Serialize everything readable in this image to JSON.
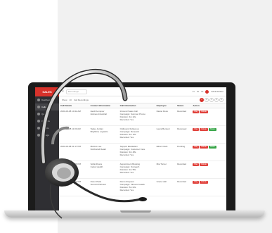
{
  "app": {
    "logo": "SALES",
    "nav": [
      "Dashboard",
      "Calls",
      "Queue",
      "Contacts",
      "Reports",
      "Settings"
    ]
  },
  "topbar": {
    "search_placeholder": "Recordings",
    "zoom": [
      "1x",
      "2x",
      "3x"
    ],
    "user": "Administrator"
  },
  "toolbar": {
    "show": "Show",
    "entries": "10",
    "filter": "Call Recordings",
    "pages": [
      "1",
      "2",
      "3",
      "4",
      "5"
    ]
  },
  "table": {
    "headers": [
      "Call Details",
      "Contact Information",
      "Call Information",
      "Employee",
      "Status",
      "Action"
    ],
    "rows": [
      {
        "details": "2021-06-08 10:42 AM",
        "contact": "Heidi Kempner\nHolmes Industrial",
        "info": "Inbound Sales Call\nCampaign: Summer Promo\nDuration: 4m 22s\nRecorded: Yes",
        "employee": "Daniel Ross",
        "status": "Recorded",
        "actions": [
          "Play",
          "Delete"
        ]
      },
      {
        "details": "2021-06-08 11:03 AM",
        "contact": "Tadeo Jordan\nBrightline Logistics",
        "info": "Outbound Follow-up\nCampaign: Renewal\nDuration: 6m 10s\nRecorded: Yes",
        "employee": "Laura Bennett",
        "status": "Reviewed",
        "actions": [
          "Play",
          "Delete",
          "Share"
        ]
      },
      {
        "details": "2021-06-08 01:17 PM",
        "contact": "Marcus Lee\nNorthwind Retail",
        "info": "Support Escalation\nCampaign: Customer Care\nDuration: 3m 48s\nRecorded: Yes",
        "employee": "Ethan Clark",
        "status": "Pending",
        "actions": [
          "Play",
          "Delete",
          "Share"
        ]
      },
      {
        "details": "2021-06-08 02:29 PM",
        "contact": "Sofia Rivera\nCedar Health",
        "info": "Appointment Booking\nCampaign: Outreach\nDuration: 2m 55s\nRecorded: Yes",
        "employee": "Mia Turner",
        "status": "Recorded",
        "actions": [
          "Play",
          "Delete"
        ]
      },
      {
        "details": "2021-06-08 03:51 PM",
        "contact": "Owen Patel\nSummit Partners",
        "info": "Demo Request\nCampaign: Inbound Leads\nDuration: 5m 02s\nRecorded: Yes",
        "employee": "Grace Hall",
        "status": "Recorded",
        "actions": [
          "Play",
          "Delete"
        ]
      }
    ]
  },
  "colors": {
    "accent": "#d8322b",
    "sidebar": "#2f2f33",
    "success": "#3aa64a"
  }
}
